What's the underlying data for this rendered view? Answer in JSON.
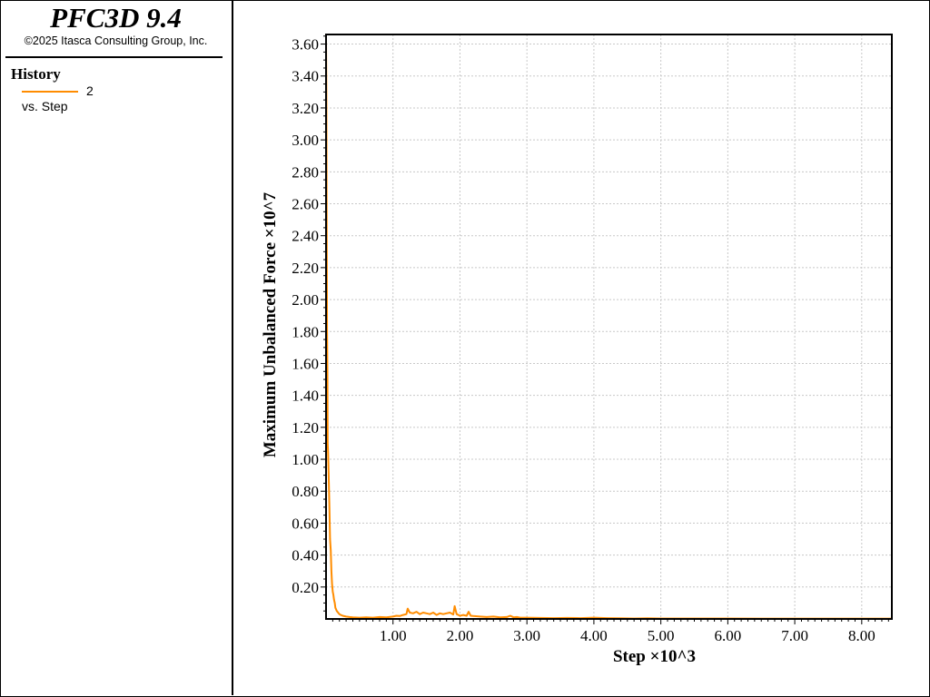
{
  "app": {
    "title": "PFC3D 9.4",
    "copyright": "©2025 Itasca Consulting Group, Inc."
  },
  "legend": {
    "title": "History",
    "items": [
      {
        "name": "2",
        "subtitle": "vs. Step",
        "color": "#ff8c00"
      }
    ]
  },
  "chart_data": {
    "type": "line",
    "xlabel": "Step ×10^3",
    "ylabel": "Maximum Unbalanced Force ×10^7",
    "xlim": [
      0,
      8.45
    ],
    "ylim": [
      0,
      3.66
    ],
    "xticks": [
      "1.00",
      "2.00",
      "3.00",
      "4.00",
      "5.00",
      "6.00",
      "7.00",
      "8.00"
    ],
    "yticks": [
      "0.20",
      "0.40",
      "0.60",
      "0.80",
      "1.00",
      "1.20",
      "1.40",
      "1.60",
      "1.80",
      "2.00",
      "2.20",
      "2.40",
      "2.60",
      "2.80",
      "3.00",
      "3.20",
      "3.40",
      "3.60"
    ],
    "grid": true,
    "series": [
      {
        "name": "2",
        "color": "#ff8c00",
        "x": [
          0,
          0.005,
          0.01,
          0.015,
          0.02,
          0.025,
          0.03,
          0.04,
          0.05,
          0.06,
          0.07,
          0.08,
          0.09,
          0.1,
          0.11,
          0.12,
          0.13,
          0.14,
          0.16,
          0.18,
          0.2,
          0.22,
          0.25,
          0.3,
          0.35,
          0.4,
          0.5,
          0.6,
          0.7,
          0.8,
          0.9,
          1.0,
          1.05,
          1.1,
          1.15,
          1.2,
          1.22,
          1.25,
          1.3,
          1.35,
          1.4,
          1.45,
          1.5,
          1.55,
          1.6,
          1.65,
          1.7,
          1.75,
          1.8,
          1.85,
          1.9,
          1.92,
          1.95,
          2.0,
          2.05,
          2.1,
          2.13,
          2.16,
          2.2,
          2.3,
          2.4,
          2.5,
          2.6,
          2.7,
          2.75,
          2.8,
          2.85,
          2.9,
          3.0,
          3.2,
          3.4,
          3.6,
          3.8,
          4.0,
          4.2,
          4.4,
          4.6,
          4.8,
          5.0,
          5.5,
          6.0,
          6.5,
          7.0,
          7.5,
          8.0,
          8.45
        ],
        "values": [
          3.65,
          3.3,
          2.5,
          1.8,
          1.55,
          1.1,
          1.05,
          0.9,
          0.7,
          0.5,
          0.43,
          0.3,
          0.22,
          0.17,
          0.15,
          0.12,
          0.1,
          0.07,
          0.05,
          0.04,
          0.03,
          0.025,
          0.02,
          0.015,
          0.012,
          0.01,
          0.008,
          0.01,
          0.008,
          0.012,
          0.01,
          0.015,
          0.02,
          0.018,
          0.025,
          0.03,
          0.065,
          0.04,
          0.035,
          0.045,
          0.03,
          0.04,
          0.035,
          0.03,
          0.04,
          0.025,
          0.035,
          0.03,
          0.035,
          0.04,
          0.028,
          0.08,
          0.03,
          0.02,
          0.025,
          0.02,
          0.045,
          0.02,
          0.018,
          0.015,
          0.012,
          0.015,
          0.01,
          0.012,
          0.02,
          0.01,
          0.012,
          0.008,
          0.008,
          0.006,
          0.005,
          0.006,
          0.005,
          0.008,
          0.005,
          0.004,
          0.003,
          0.004,
          0.003,
          0.003,
          0.003,
          0.002,
          0.002,
          0.002,
          0.002,
          0.002
        ]
      }
    ]
  }
}
